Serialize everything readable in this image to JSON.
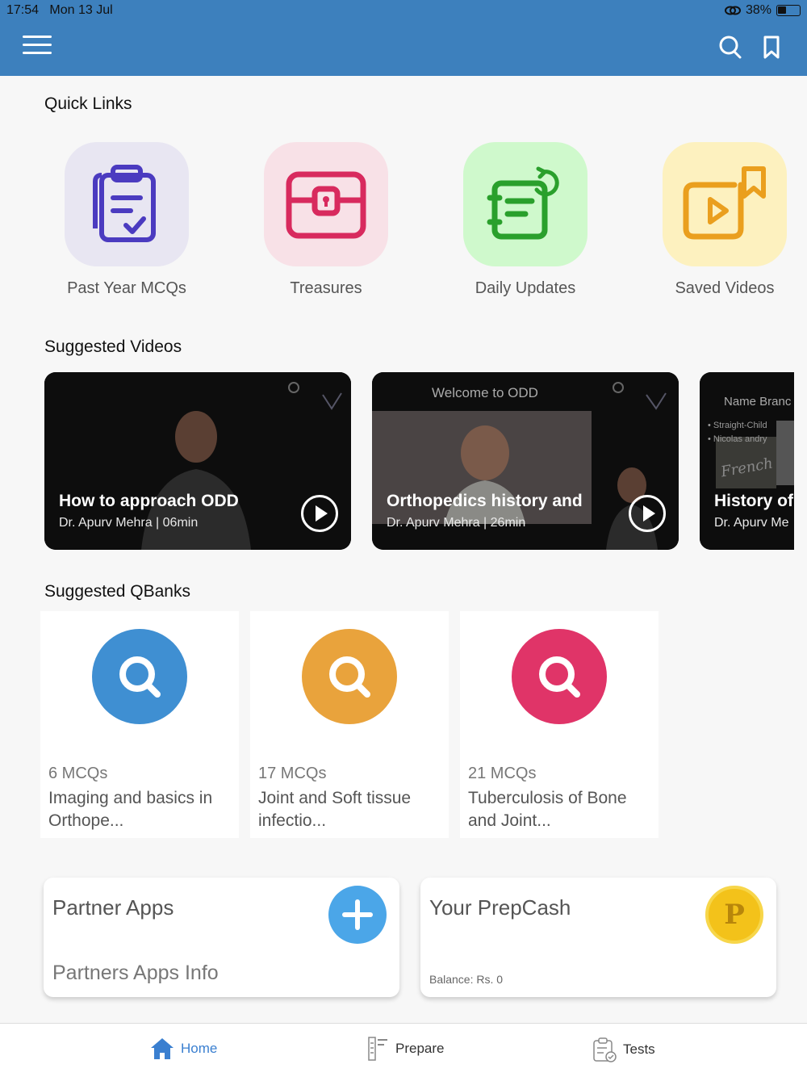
{
  "status_bar": {
    "time": "17:54",
    "date": "Mon 13 Jul",
    "battery": "38%"
  },
  "header": {
    "menu_icon": "hamburger-menu-icon",
    "search_icon": "search-icon",
    "bookmark_icon": "bookmark-icon",
    "color": "#3d80bd"
  },
  "quick_links": {
    "title": "Quick Links",
    "items": [
      {
        "label": "Past Year MCQs",
        "icon": "clipboard-check-icon",
        "bg": "#e8e6f2",
        "fg": "#4b3bc0"
      },
      {
        "label": "Treasures",
        "icon": "treasure-chest-icon",
        "bg": "#f8e1e7",
        "fg": "#d82a5e"
      },
      {
        "label": "Daily Updates",
        "icon": "notes-refresh-icon",
        "bg": "#cff9cc",
        "fg": "#2aa02c"
      },
      {
        "label": "Saved Videos",
        "icon": "video-bookmark-icon",
        "bg": "#fdf1bf",
        "fg": "#ea9f1e"
      }
    ]
  },
  "suggested_videos": {
    "title": "Suggested Videos",
    "items": [
      {
        "title": "How to approach ODD",
        "author": "Dr. Apurv Mehra",
        "duration": "06min"
      },
      {
        "title": "Orthopedics history and",
        "author": "Dr. Apurv Mehra",
        "duration": "26min",
        "slide_heading": "Welcome to ODD"
      },
      {
        "title": "History of",
        "author": "Dr. Apurv Me",
        "duration": "",
        "slide_heading": "Name Branc",
        "slide_bullets": [
          "Straight-Child",
          "Nicolas andry"
        ],
        "slide_script": "French"
      }
    ]
  },
  "suggested_qbanks": {
    "title": "Suggested QBanks",
    "items": [
      {
        "count": "6 MCQs",
        "name": "Imaging  and basics in Orthope...",
        "color": "#3f8fd2"
      },
      {
        "count": "17 MCQs",
        "name": "Joint and Soft tissue infectio...",
        "color": "#e9a33c"
      },
      {
        "count": "21 MCQs",
        "name": "Tuberculosis of Bone and Joint...",
        "color": "#e03468"
      }
    ]
  },
  "partner_apps": {
    "title": "Partner Apps",
    "subtitle": "Partners Apps Info"
  },
  "prepcash": {
    "title": "Your PrepCash",
    "balance": "Balance: Rs. 0",
    "coin_letter": "P"
  },
  "bottom_nav": [
    {
      "label": "Home",
      "icon": "home-icon",
      "active": true
    },
    {
      "label": "Prepare",
      "icon": "prepare-icon",
      "active": false
    },
    {
      "label": "Tests",
      "icon": "tests-clipboard-icon",
      "active": false
    }
  ]
}
